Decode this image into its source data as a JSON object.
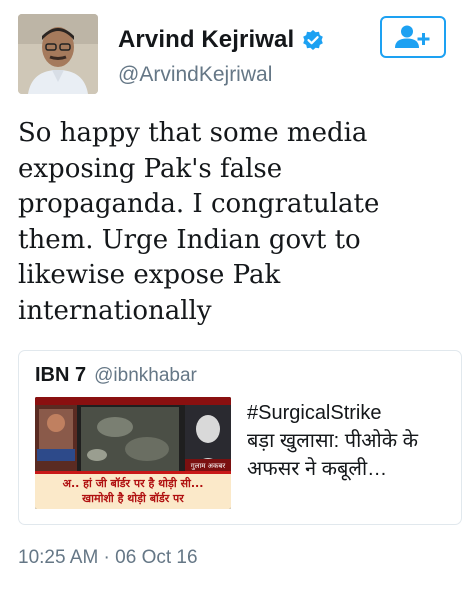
{
  "tweet": {
    "author_name": "Arvind Kejriwal",
    "author_handle": "@ArvindKejriwal",
    "text": "So happy that some media\nexposing Pak's false\npropaganda. I congratulate\nthem. Urge Indian govt to\nlikewise expose Pak\ninternationally",
    "timestamp": "10:25 AM · 06 Oct 16"
  },
  "quoted_tweet": {
    "author_name": "IBN 7",
    "author_handle": "@ibnkhabar",
    "text_line1": "#SurgicalStrike",
    "text_line2": "बड़ा खुलासा: पीओके के अफसर ने कबूली…",
    "thumbnail_caption_line1": "अ.. हां जी बॉर्डर पर है थोड़ी सी...",
    "thumbnail_caption_line2": "खामोशी है थोड़ी बॉर्डर पर",
    "thumbnail_tag": "गुलाम अकबर"
  },
  "colors": {
    "accent": "#1da1f2",
    "secondary_text": "#657786",
    "border": "#e1e8ed"
  },
  "icons": {
    "verified": "verified-badge-icon",
    "follow": "add-user-icon"
  }
}
